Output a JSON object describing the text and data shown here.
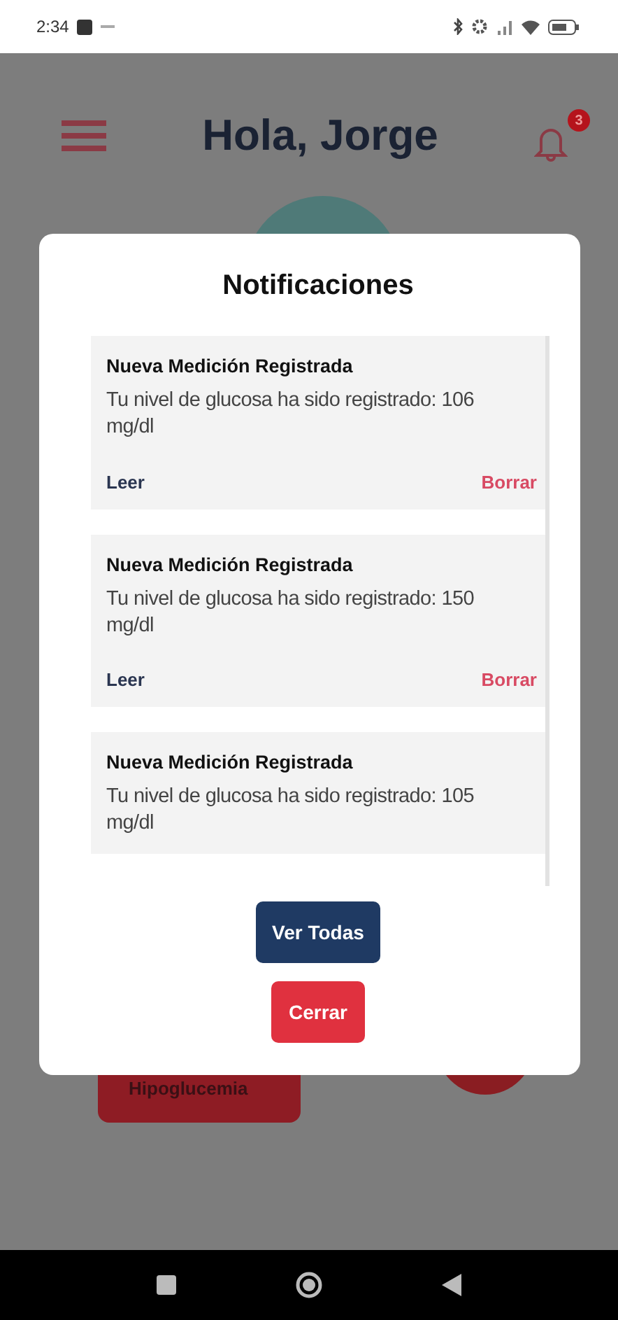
{
  "status_bar": {
    "time": "2:34"
  },
  "header": {
    "title": "Hola, Jorge",
    "notification_count": "3"
  },
  "background_card": {
    "label": "Hipoglucemia"
  },
  "modal": {
    "title": "Notificaciones",
    "notifications": [
      {
        "title": "Nueva Medición Registrada",
        "body": "Tu nivel de glucosa ha sido registrado: 106 mg/dl",
        "actions": [
          "Leer",
          "Borrar"
        ]
      },
      {
        "title": "Nueva Medición Registrada",
        "body": "Tu nivel de glucosa ha sido registrado: 150 mg/dl",
        "actions": [
          "Leer",
          "Borrar"
        ]
      },
      {
        "title": "Nueva Medición Registrada",
        "body": "Tu nivel de glucosa ha sido registrado: 105 mg/dl"
      }
    ],
    "buttons": [
      "Ver Todas",
      "Cerrar"
    ]
  }
}
